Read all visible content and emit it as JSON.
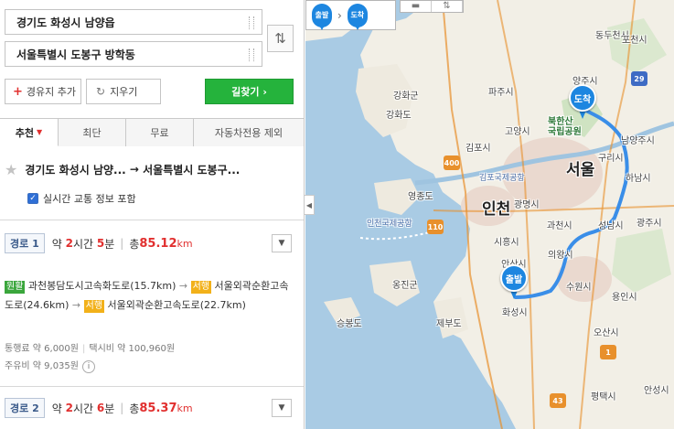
{
  "search": {
    "start": "경기도 화성시 남양읍",
    "end": "서울특별시 도봉구 방학동",
    "add_waypoint": "경유지 추가",
    "clear": "지우기",
    "find_route": "길찾기"
  },
  "tabs": [
    {
      "label": "추천",
      "active": true
    },
    {
      "label": "최단",
      "active": false
    },
    {
      "label": "무료",
      "active": false
    },
    {
      "label": "자동차전용 제외",
      "active": false
    }
  ],
  "summary": {
    "from": "경기도 화성시 남양...",
    "arrow": "→",
    "to": "서울특별시 도봉구...",
    "traffic_label": "실시간 교통 정보 포함",
    "traffic_checked": true
  },
  "routes": [
    {
      "badge": "경로 1",
      "time_prefix": "약",
      "hours": "2",
      "hours_unit": "시간",
      "minutes": "5",
      "minutes_unit": "분",
      "total_label": "총",
      "distance": "85.12",
      "distance_unit": "km",
      "segments": {
        "tag1": "원활",
        "road1": "과천봉담도시고속화도로(15.7km)",
        "tag2": "서행",
        "road2": "서울외곽순환고속도로(24.6km)",
        "tag3": "서행",
        "road3": "서울외곽순환고속도로(22.7km)"
      },
      "toll": "통행료 약 6,000원",
      "taxi": "택시비 약 100,960원",
      "fuel": "주유비 약 9,035원"
    },
    {
      "badge": "경로 2",
      "time_prefix": "약",
      "hours": "2",
      "hours_unit": "시간",
      "minutes": "6",
      "minutes_unit": "분",
      "total_label": "총",
      "distance": "85.37",
      "distance_unit": "km"
    }
  ],
  "map": {
    "legend_start": "출발",
    "legend_end": "도착",
    "pin_start": "출발",
    "pin_end": "도착",
    "labels": {
      "dongducheon": "동두천시",
      "pocheon": "포천시",
      "yangju": "양주시",
      "paju": "파주시",
      "ganghwagun": "강화군",
      "ganghwado": "강화도",
      "goyang": "고양시",
      "bukhansan": "북한산\n국립공원",
      "namyangju": "남양주시",
      "guri": "구리시",
      "gimpo": "김포시",
      "gimpo_airport": "김포국제공항",
      "seoul": "서울",
      "hanam": "하남시",
      "yeongjongdo": "영종도",
      "incheon": "인천",
      "gwangmyeong": "광명시",
      "incheon_airport": "인천국제공항",
      "gwacheon": "과천시",
      "seongnam": "성남시",
      "gwangju": "광주시",
      "siheung": "시흥시",
      "ansan": "안산시",
      "uiwang": "의왕시",
      "yongin": "용인시",
      "suwon": "수원시",
      "ongjin": "옹진군",
      "jebu": "제부도",
      "seungbong": "승봉도",
      "hwaseong": "화성시",
      "osan": "오산시",
      "pyeongtaek": "평택시",
      "anseong": "안성시"
    }
  },
  "colors": {
    "accent_green": "#25b33c",
    "accent_red": "#e1302f",
    "route_blue": "#3a8ee8",
    "pin_blue": "#1d86e0"
  }
}
